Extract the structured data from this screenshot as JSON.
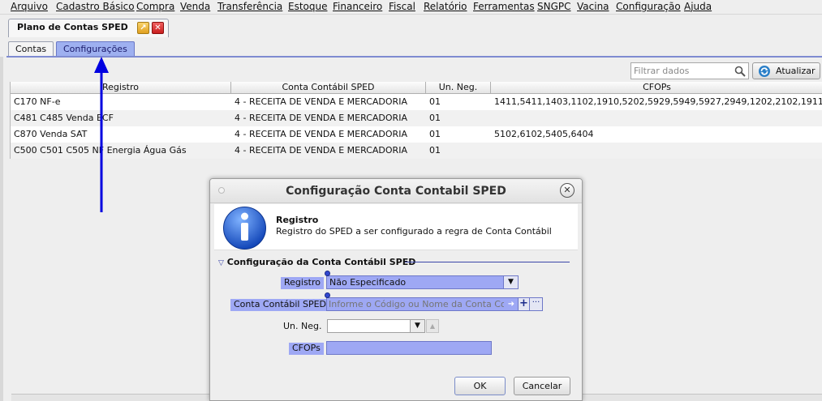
{
  "menu": {
    "items": [
      "Arquivo",
      "Cadastro Básico",
      "Compra",
      "Venda",
      "Transferência",
      "Estoque",
      "Financeiro",
      "Fiscal",
      "Relatório",
      "Ferramentas",
      "SNGPC",
      "Vacina",
      "Configuração",
      "Ajuda"
    ]
  },
  "document_tab": {
    "label": "Plano de Contas SPED"
  },
  "subtabs": {
    "contas": "Contas",
    "configuracoes": "Configurações",
    "active": "configuracoes"
  },
  "toolbar": {
    "filter_placeholder": "Filtrar dados",
    "refresh_label": "Atualizar",
    "search_icon": "search-icon",
    "refresh_icon": "refresh-icon"
  },
  "table": {
    "columns": [
      "Registro",
      "Conta Contábil SPED",
      "Un. Neg.",
      "CFOPs"
    ],
    "rows": [
      [
        "C170 NF-e",
        "4 - RECEITA DE VENDA E MERCADORIA",
        "01",
        "1411,5411,1403,1102,1910,5202,5929,5949,5927,2949,1202,2102,1911"
      ],
      [
        "C481 C485 Venda ECF",
        "4 - RECEITA DE VENDA E MERCADORIA",
        "01",
        ""
      ],
      [
        "C870 Venda SAT",
        "4 - RECEITA DE VENDA E MERCADORIA",
        "01",
        "5102,6102,5405,6404"
      ],
      [
        "C500 C501 C505 NF Energia Água Gás",
        "4 - RECEITA DE VENDA E MERCADORIA",
        "01",
        ""
      ]
    ]
  },
  "dialog": {
    "title": "Configuração Conta Contabil SPED",
    "info_heading": "Registro",
    "info_text": "Registro do SPED a ser configurado a regra de Conta Contábil",
    "section_title": "Configuração da Conta Contábil SPED",
    "fields": {
      "registro_label": "Registro",
      "registro_value": "Não Especificado",
      "conta_label": "Conta Contábil SPED",
      "conta_placeholder": "Informe o Código ou Nome da Conta Contábil",
      "un_neg_label": "Un. Neg.",
      "un_neg_value": "",
      "cfops_label": "CFOPs",
      "cfops_value": ""
    },
    "ok_label": "OK",
    "cancel_label": "Cancelar"
  },
  "colors": {
    "highlight": "#9ea8f4",
    "active_tab": "#9eb0f0",
    "annotation_arrow": "#0000e0",
    "info_icon": "#1f5fd6"
  }
}
